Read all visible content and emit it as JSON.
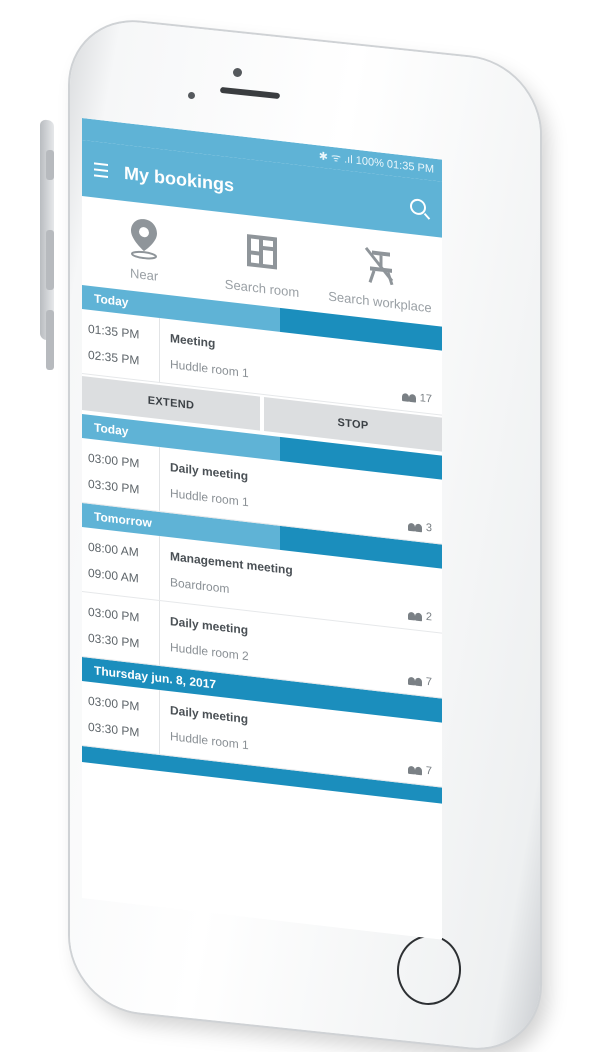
{
  "status_bar": {
    "text": "✱ ᯤ .ıl 100% 01:35 PM"
  },
  "app_bar": {
    "title": "My bookings"
  },
  "quick_actions": [
    {
      "label": "Near",
      "icon": "location-pin-icon"
    },
    {
      "label": "Search room",
      "icon": "floorplan-icon"
    },
    {
      "label": "Search workplace",
      "icon": "desk-chair-icon"
    }
  ],
  "sections": [
    {
      "header": "Today",
      "bookings": [
        {
          "start": "01:35 PM",
          "end": "02:35 PM",
          "title": "Meeting",
          "room": "Huddle room 1",
          "attendees": "17"
        }
      ],
      "actions": {
        "extend": "EXTEND",
        "stop": "STOP"
      }
    },
    {
      "header": "Today",
      "bookings": [
        {
          "start": "03:00 PM",
          "end": "03:30 PM",
          "title": "Daily meeting",
          "room": "Huddle room 1",
          "attendees": "3"
        }
      ]
    },
    {
      "header": "Tomorrow",
      "bookings": [
        {
          "start": "08:00 AM",
          "end": "09:00 AM",
          "title": "Management meeting",
          "room": "Boardroom",
          "attendees": "2"
        },
        {
          "start": "03:00 PM",
          "end": "03:30 PM",
          "title": "Daily meeting",
          "room": "Huddle room 2",
          "attendees": "7"
        }
      ]
    },
    {
      "header": "Thursday jun. 8, 2017",
      "bookings": [
        {
          "start": "03:00 PM",
          "end": "03:30 PM",
          "title": "Daily meeting",
          "room": "Huddle room 1",
          "attendees": "7"
        }
      ]
    }
  ],
  "colors": {
    "primary_light": "#5fb3d6",
    "primary_dark": "#1b8ebd",
    "button_gray": "#dcdee0"
  }
}
